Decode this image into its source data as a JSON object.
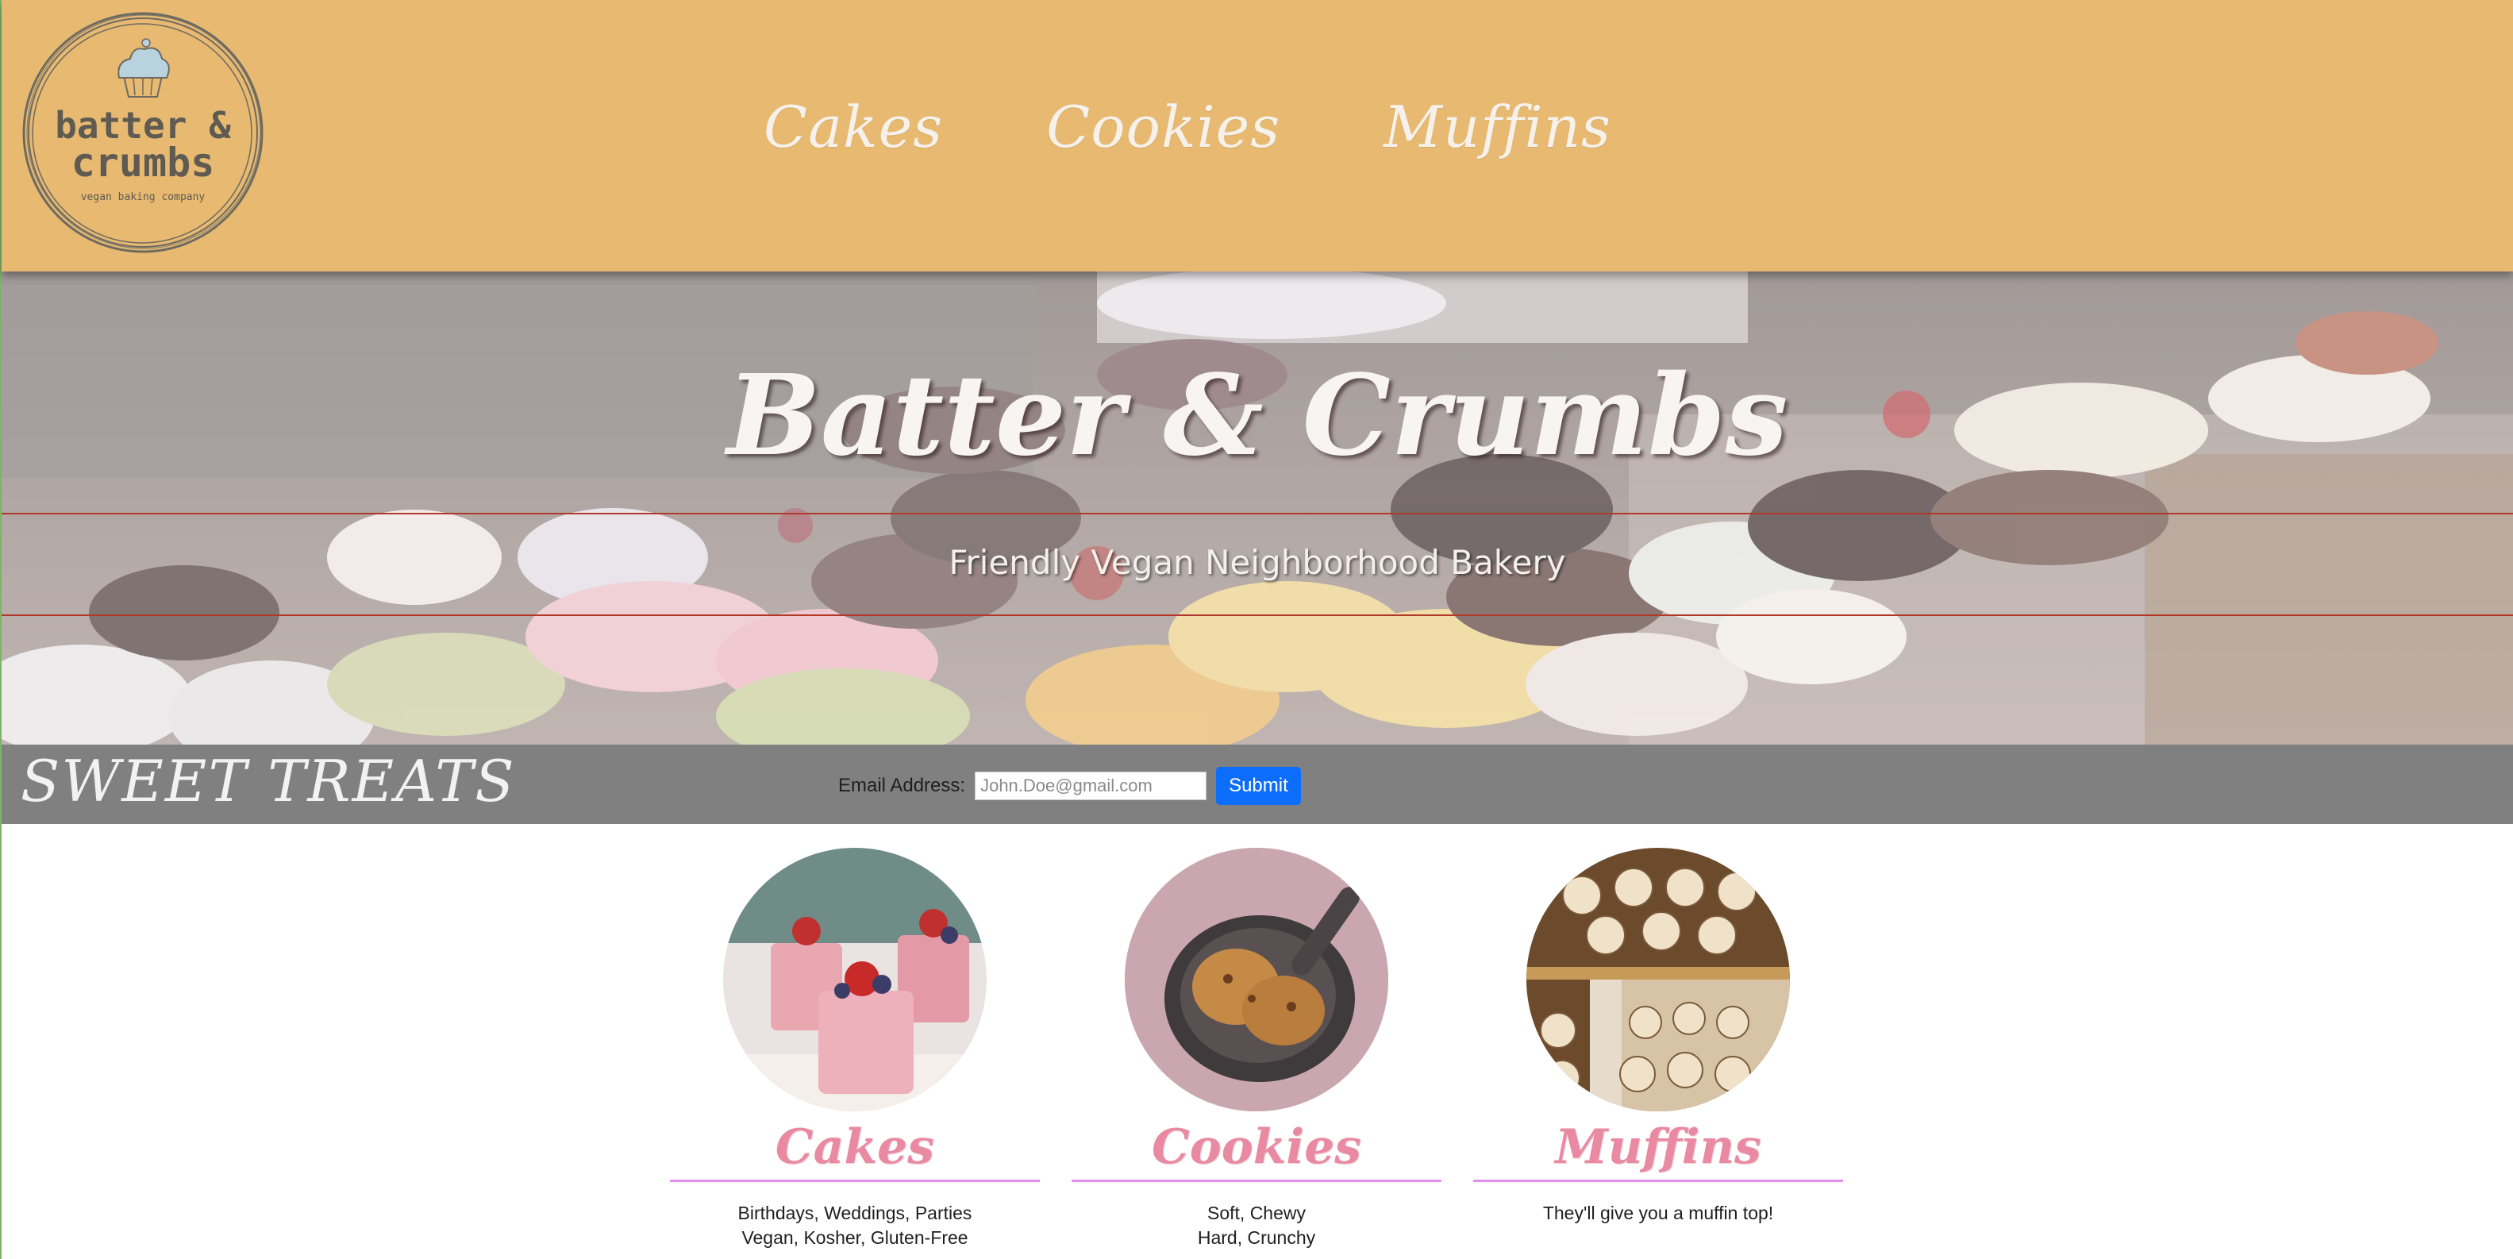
{
  "brand": {
    "logo_line1": "batter &",
    "logo_line2": "crumbs",
    "logo_tagline": "vegan baking company"
  },
  "nav": {
    "items": [
      {
        "label": "Cakes"
      },
      {
        "label": "Cookies"
      },
      {
        "label": "Muffins"
      }
    ]
  },
  "hero": {
    "title": "Batter & Crumbs",
    "subtitle": "Friendly Vegan Neighborhood Bakery"
  },
  "signup": {
    "section_title": "SWEET TREATS",
    "email_label": "Email Address:",
    "email_placeholder": "John.Doe@gmail.com",
    "email_value": "",
    "submit_label": "Submit"
  },
  "products": [
    {
      "name": "Cakes",
      "lines": [
        "Birthdays, Weddings, Parties",
        "Vegan, Kosher, Gluten-Free"
      ]
    },
    {
      "name": "Cookies",
      "lines": [
        "Soft, Chewy",
        "Hard, Crunchy"
      ]
    },
    {
      "name": "Muffins",
      "lines": [
        "They'll give you a muffin top!"
      ]
    }
  ],
  "colors": {
    "header_bg": "#e7b971",
    "strip_bg": "#808080",
    "product_name": "#e98aa2",
    "product_rule": "#e48ff0",
    "submit_bg": "#0d6efd"
  }
}
